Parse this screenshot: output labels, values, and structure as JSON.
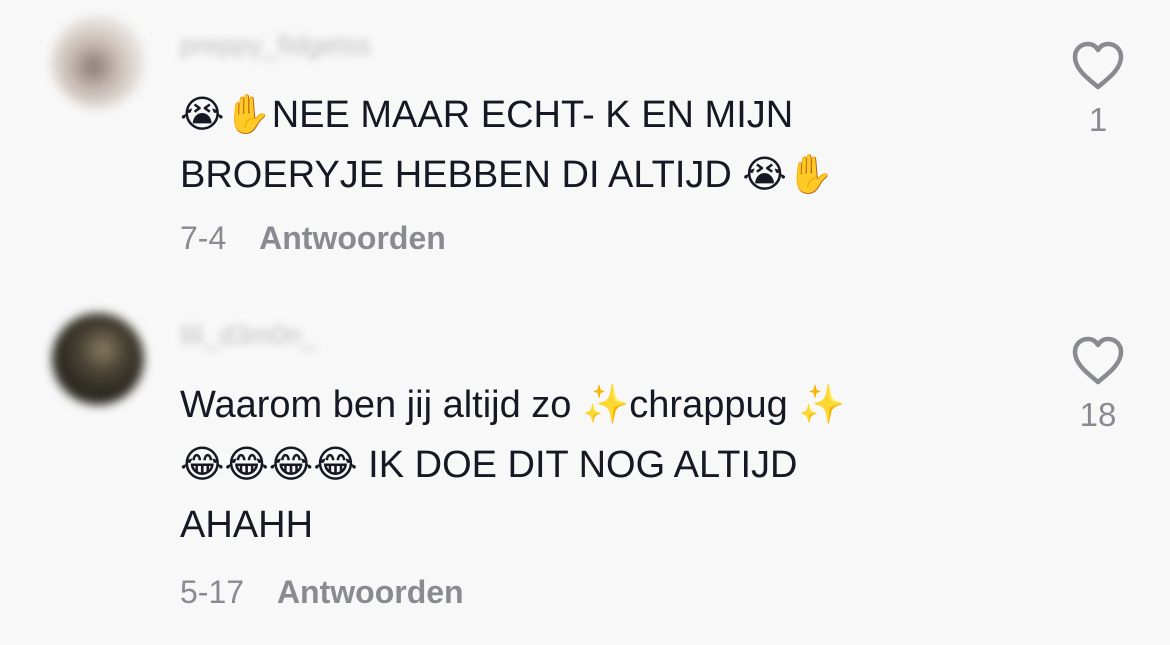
{
  "comments": [
    {
      "username": "preppy_fidgetss",
      "text": "😭✋NEE MAAR ECHT- K EN MIJN BROERYJE HEBBEN DI ALTIJD 😭✋",
      "date": "7-4",
      "reply_label": "Antwoorden",
      "likes": "1",
      "like_icon": "heart-outline-icon"
    },
    {
      "username": "lili_d3m0n_",
      "text": "Waarom ben jij altijd zo ✨chrappug ✨\n😂😂😂😂 IK DOE DIT NOG ALTIJD\nAHAHH",
      "date": "5-17",
      "reply_label": "Antwoorden",
      "likes": "18",
      "like_icon": "heart-outline-icon"
    }
  ],
  "colors": {
    "background": "#f8f8f8",
    "text": "#161823",
    "secondary": "#8a8b91"
  }
}
